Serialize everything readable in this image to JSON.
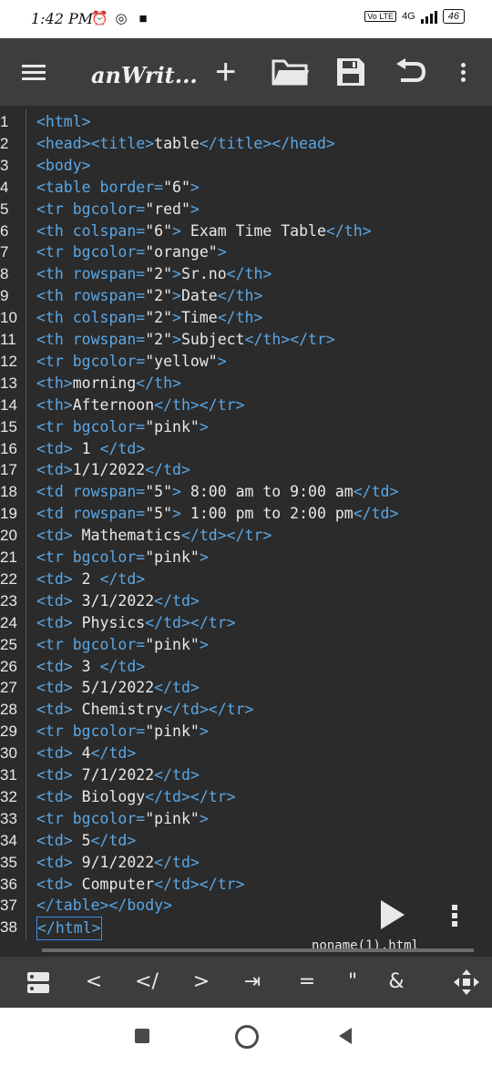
{
  "status": {
    "time": "1:42 PM",
    "network": "4G",
    "lte": "Vo LTE",
    "battery": "46"
  },
  "toolbar": {
    "title": "anWrit..."
  },
  "editor": {
    "lines": [
      {
        "n": "1",
        "parts": [
          [
            "tg",
            "<html>"
          ]
        ]
      },
      {
        "n": "2",
        "parts": [
          [
            "tg",
            "<head><title>"
          ],
          [
            "tx",
            "table"
          ],
          [
            "tg",
            "</title></head>"
          ]
        ]
      },
      {
        "n": "3",
        "parts": [
          [
            "tg",
            "<body>"
          ]
        ]
      },
      {
        "n": "4",
        "parts": [
          [
            "tg",
            "<table border="
          ],
          [
            "vl",
            "\"6\""
          ],
          [
            "tg",
            ">"
          ]
        ]
      },
      {
        "n": "5",
        "parts": [
          [
            "tg",
            "<tr bgcolor="
          ],
          [
            "vl",
            "\"red\""
          ],
          [
            "tg",
            ">"
          ]
        ]
      },
      {
        "n": "6",
        "parts": [
          [
            "tg",
            "<th colspan="
          ],
          [
            "vl",
            "\"6\""
          ],
          [
            "tg",
            ">"
          ],
          [
            "tx",
            " Exam Time Table"
          ],
          [
            "tg",
            "</th>"
          ]
        ]
      },
      {
        "n": "7",
        "parts": [
          [
            "tg",
            "<tr bgcolor="
          ],
          [
            "vl",
            "\"orange\""
          ],
          [
            "tg",
            ">"
          ]
        ]
      },
      {
        "n": "8",
        "parts": [
          [
            "tg",
            "<th rowspan="
          ],
          [
            "vl",
            "\"2\""
          ],
          [
            "tg",
            ">"
          ],
          [
            "tx",
            "Sr.no"
          ],
          [
            "tg",
            "</th>"
          ]
        ]
      },
      {
        "n": "9",
        "parts": [
          [
            "tg",
            "<th rowspan="
          ],
          [
            "vl",
            "\"2\""
          ],
          [
            "tg",
            ">"
          ],
          [
            "tx",
            "Date"
          ],
          [
            "tg",
            "</th>"
          ]
        ]
      },
      {
        "n": "10",
        "parts": [
          [
            "tg",
            "<th colspan="
          ],
          [
            "vl",
            "\"2\""
          ],
          [
            "tg",
            ">"
          ],
          [
            "tx",
            "Time"
          ],
          [
            "tg",
            "</th>"
          ]
        ]
      },
      {
        "n": "11",
        "parts": [
          [
            "tg",
            "<th rowspan="
          ],
          [
            "vl",
            "\"2\""
          ],
          [
            "tg",
            ">"
          ],
          [
            "tx",
            "Subject"
          ],
          [
            "tg",
            "</th></tr>"
          ]
        ]
      },
      {
        "n": "12",
        "parts": [
          [
            "tg",
            "<tr bgcolor="
          ],
          [
            "vl",
            "\"yellow\""
          ],
          [
            "tg",
            ">"
          ]
        ]
      },
      {
        "n": "13",
        "parts": [
          [
            "tg",
            "<th>"
          ],
          [
            "tx",
            "morning"
          ],
          [
            "tg",
            "</th>"
          ]
        ]
      },
      {
        "n": "14",
        "parts": [
          [
            "tg",
            "<th>"
          ],
          [
            "tx",
            "Afternoon"
          ],
          [
            "tg",
            "</th></tr>"
          ]
        ]
      },
      {
        "n": "15",
        "parts": [
          [
            "tg",
            "<tr bgcolor="
          ],
          [
            "vl",
            "\"pink\""
          ],
          [
            "tg",
            ">"
          ]
        ]
      },
      {
        "n": "16",
        "parts": [
          [
            "tg",
            "<td>"
          ],
          [
            "tx",
            " 1 "
          ],
          [
            "tg",
            "</td>"
          ]
        ]
      },
      {
        "n": "17",
        "parts": [
          [
            "tg",
            "<td>"
          ],
          [
            "tx",
            "1/1/2022"
          ],
          [
            "tg",
            "</td>"
          ]
        ]
      },
      {
        "n": "18",
        "parts": [
          [
            "tg",
            "<td rowspan="
          ],
          [
            "vl",
            "\"5\""
          ],
          [
            "tg",
            ">"
          ],
          [
            "tx",
            " 8:00 am to 9:00 am"
          ],
          [
            "tg",
            "</td>"
          ]
        ]
      },
      {
        "n": "19",
        "parts": [
          [
            "tg",
            "<td rowspan="
          ],
          [
            "vl",
            "\"5\""
          ],
          [
            "tg",
            ">"
          ],
          [
            "tx",
            " 1:00 pm to 2:00 pm"
          ],
          [
            "tg",
            "</td>"
          ]
        ]
      },
      {
        "n": "20",
        "parts": [
          [
            "tg",
            "<td>"
          ],
          [
            "tx",
            " Mathematics"
          ],
          [
            "tg",
            "</td></tr>"
          ]
        ]
      },
      {
        "n": "21",
        "parts": [
          [
            "tg",
            "<tr bgcolor="
          ],
          [
            "vl",
            "\"pink\""
          ],
          [
            "tg",
            ">"
          ]
        ]
      },
      {
        "n": "22",
        "parts": [
          [
            "tg",
            "<td>"
          ],
          [
            "tx",
            " 2 "
          ],
          [
            "tg",
            "</td>"
          ]
        ]
      },
      {
        "n": "23",
        "parts": [
          [
            "tg",
            "<td>"
          ],
          [
            "tx",
            " 3/1/2022"
          ],
          [
            "tg",
            "</td>"
          ]
        ]
      },
      {
        "n": "24",
        "parts": [
          [
            "tg",
            "<td>"
          ],
          [
            "tx",
            " Physics"
          ],
          [
            "tg",
            "</td></tr>"
          ]
        ]
      },
      {
        "n": "25",
        "parts": [
          [
            "tg",
            "<tr bgcolor="
          ],
          [
            "vl",
            "\"pink\""
          ],
          [
            "tg",
            ">"
          ]
        ]
      },
      {
        "n": "26",
        "parts": [
          [
            "tg",
            "<td>"
          ],
          [
            "tx",
            " 3 "
          ],
          [
            "tg",
            "</td>"
          ]
        ]
      },
      {
        "n": "27",
        "parts": [
          [
            "tg",
            "<td>"
          ],
          [
            "tx",
            " 5/1/2022"
          ],
          [
            "tg",
            "</td>"
          ]
        ]
      },
      {
        "n": "28",
        "parts": [
          [
            "tg",
            "<td>"
          ],
          [
            "tx",
            " Chemistry"
          ],
          [
            "tg",
            "</td></tr>"
          ]
        ]
      },
      {
        "n": "29",
        "parts": [
          [
            "tg",
            "<tr bgcolor="
          ],
          [
            "vl",
            "\"pink\""
          ],
          [
            "tg",
            ">"
          ]
        ]
      },
      {
        "n": "30",
        "parts": [
          [
            "tg",
            "<td>"
          ],
          [
            "tx",
            " 4"
          ],
          [
            "tg",
            "</td>"
          ]
        ]
      },
      {
        "n": "31",
        "parts": [
          [
            "tg",
            "<td>"
          ],
          [
            "tx",
            " 7/1/2022"
          ],
          [
            "tg",
            "</td>"
          ]
        ]
      },
      {
        "n": "32",
        "parts": [
          [
            "tg",
            "<td>"
          ],
          [
            "tx",
            " Biology"
          ],
          [
            "tg",
            "</td></tr>"
          ]
        ]
      },
      {
        "n": "33",
        "parts": [
          [
            "tg",
            "<tr bgcolor="
          ],
          [
            "vl",
            "\"pink\""
          ],
          [
            "tg",
            ">"
          ]
        ]
      },
      {
        "n": "34",
        "parts": [
          [
            "tg",
            "<td>"
          ],
          [
            "tx",
            " 5"
          ],
          [
            "tg",
            "</td>"
          ]
        ]
      },
      {
        "n": "35",
        "parts": [
          [
            "tg",
            "<td>"
          ],
          [
            "tx",
            " 9/1/2022"
          ],
          [
            "tg",
            "</td>"
          ]
        ]
      },
      {
        "n": "36",
        "parts": [
          [
            "tg",
            "<td>"
          ],
          [
            "tx",
            " Computer"
          ],
          [
            "tg",
            "</td></tr>"
          ]
        ]
      },
      {
        "n": "37",
        "parts": [
          [
            "tg",
            "</table></body>"
          ]
        ]
      },
      {
        "n": "38",
        "parts": [
          [
            "tg",
            "</html>"
          ]
        ]
      }
    ]
  },
  "file": {
    "name": "noname(1).html"
  },
  "keys": [
    "<",
    "</",
    ">",
    "⇥",
    "=",
    "\"",
    "&"
  ]
}
